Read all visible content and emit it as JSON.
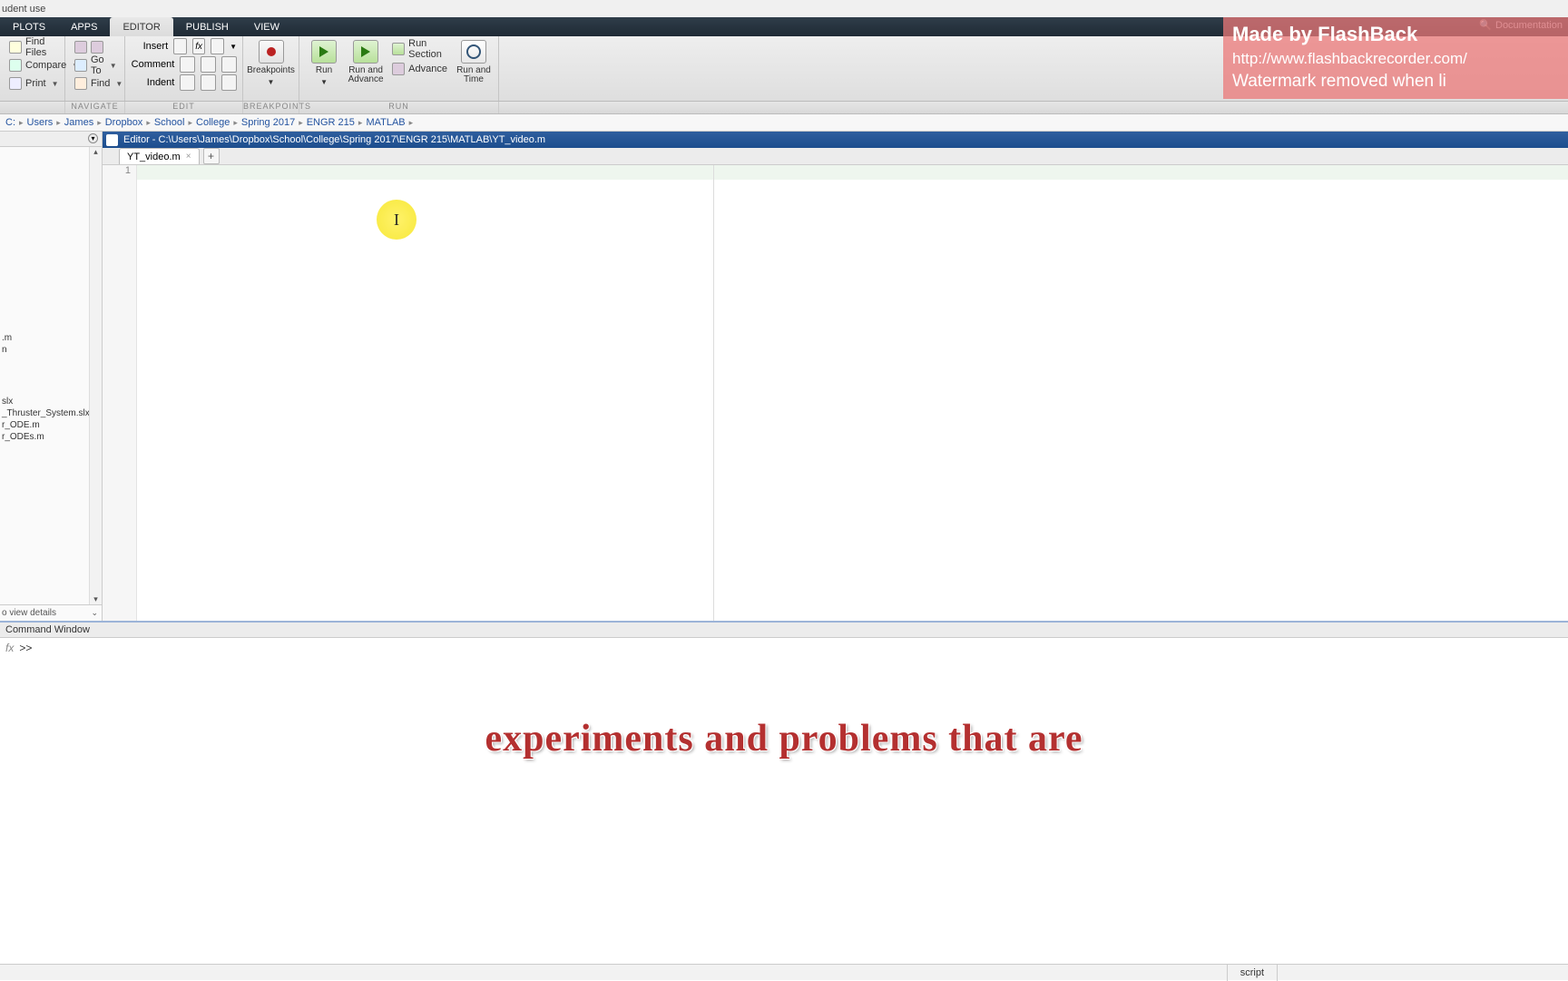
{
  "title_strip": "udent use",
  "tabs": {
    "plots": "PLOTS",
    "apps": "APPS",
    "editor": "EDITOR",
    "publish": "PUBLISH",
    "view": "VIEW"
  },
  "doc_search": "Documentation",
  "ribbon": {
    "file": {
      "findfiles": "Find Files",
      "compare": "Compare",
      "print": "Print"
    },
    "nav": {
      "goto": "Go To",
      "find": "Find"
    },
    "edit": {
      "insert": "Insert",
      "comment": "Comment",
      "indent": "Indent"
    },
    "breakpoints": "Breakpoints",
    "run": "Run",
    "runadv": "Run and Advance",
    "runsec": "Run Section",
    "advance": "Advance",
    "runtime": "Run and Time",
    "groups": {
      "navigate": "NAVIGATE",
      "edit": "EDIT",
      "breakpoints": "BREAKPOINTS",
      "run": "RUN"
    }
  },
  "breadcrumb": [
    "C:",
    "Users",
    "James",
    "Dropbox",
    "School",
    "College",
    "Spring 2017",
    "ENGR 215",
    "MATLAB"
  ],
  "sidebar": {
    "files_top": [
      ".m",
      "n"
    ],
    "files": [
      "slx",
      "_Thruster_System.slx",
      "r_ODE.m",
      "r_ODEs.m"
    ],
    "details": "o view details"
  },
  "editor": {
    "title": "Editor - C:\\Users\\James\\Dropbox\\School\\College\\Spring 2017\\ENGR 215\\MATLAB\\YT_video.m",
    "tab": "YT_video.m",
    "addtab": "+",
    "line1": "1",
    "cursor_mark": "I"
  },
  "command": {
    "title": "Command Window",
    "fx": "fx",
    "prompt": ">>"
  },
  "caption": "experiments and problems that are",
  "status": {
    "mode": "script"
  },
  "watermark": {
    "l1": "Made by FlashBack",
    "l2": "http://www.flashbackrecorder.com/",
    "l3": "Watermark removed when li"
  }
}
